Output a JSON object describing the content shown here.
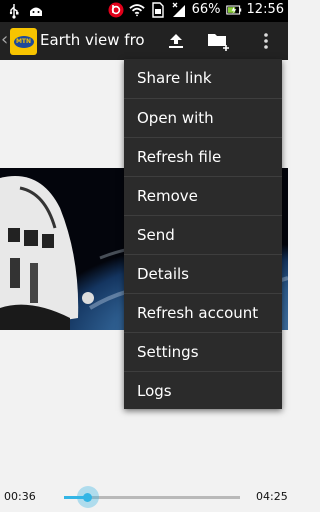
{
  "status_bar": {
    "battery_percent": "66%",
    "clock": "12:56",
    "icons": [
      "usb-icon",
      "android-icon",
      "beats-audio-icon",
      "wifi-icon",
      "sim-card-icon",
      "signal-icon",
      "battery-charging-icon"
    ]
  },
  "action_bar": {
    "title": "Earth view fro...",
    "icons": [
      "back-chevron-icon",
      "mtn-logo-icon",
      "upload-icon",
      "add-folder-icon",
      "overflow-menu-icon"
    ]
  },
  "menu": {
    "items": [
      {
        "label": "Share link"
      },
      {
        "label": "Open with"
      },
      {
        "label": "Refresh file"
      },
      {
        "label": "Remove"
      },
      {
        "label": "Send"
      },
      {
        "label": "Details"
      },
      {
        "label": "Refresh account"
      },
      {
        "label": "Settings"
      },
      {
        "label": "Logs"
      }
    ]
  },
  "player": {
    "elapsed": "00:36",
    "duration": "04:25",
    "progress_fraction": 0.136
  }
}
